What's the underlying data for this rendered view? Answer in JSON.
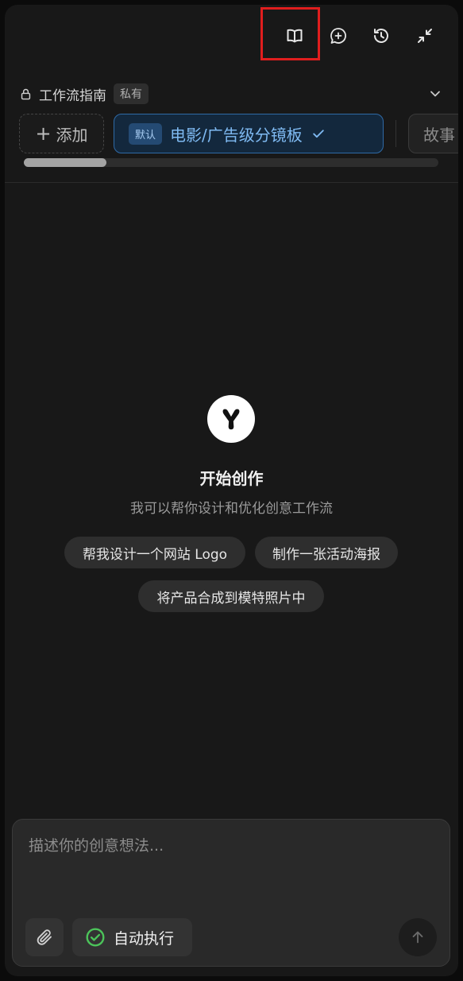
{
  "toolbar": {
    "buttons": [
      "book-icon",
      "new-chat-icon",
      "history-icon",
      "collapse-icon"
    ]
  },
  "guide": {
    "title": "工作流指南",
    "badge": "私有"
  },
  "chips": {
    "add_label": "添加",
    "default_badge": "默认",
    "active_label": "电影/广告级分镜板",
    "next_label": "故事"
  },
  "empty_state": {
    "title": "开始创作",
    "subtitle": "我可以帮你设计和优化创意工作流",
    "suggestions": [
      "帮我设计一个网站 Logo",
      "制作一张活动海报",
      "将产品合成到模特照片中"
    ]
  },
  "input": {
    "placeholder": "描述你的创意想法...",
    "auto_label": "自动执行"
  },
  "colors": {
    "accent": "#7fbaf2",
    "highlight": "#e01e1e",
    "check_green": "#4cc45a"
  }
}
